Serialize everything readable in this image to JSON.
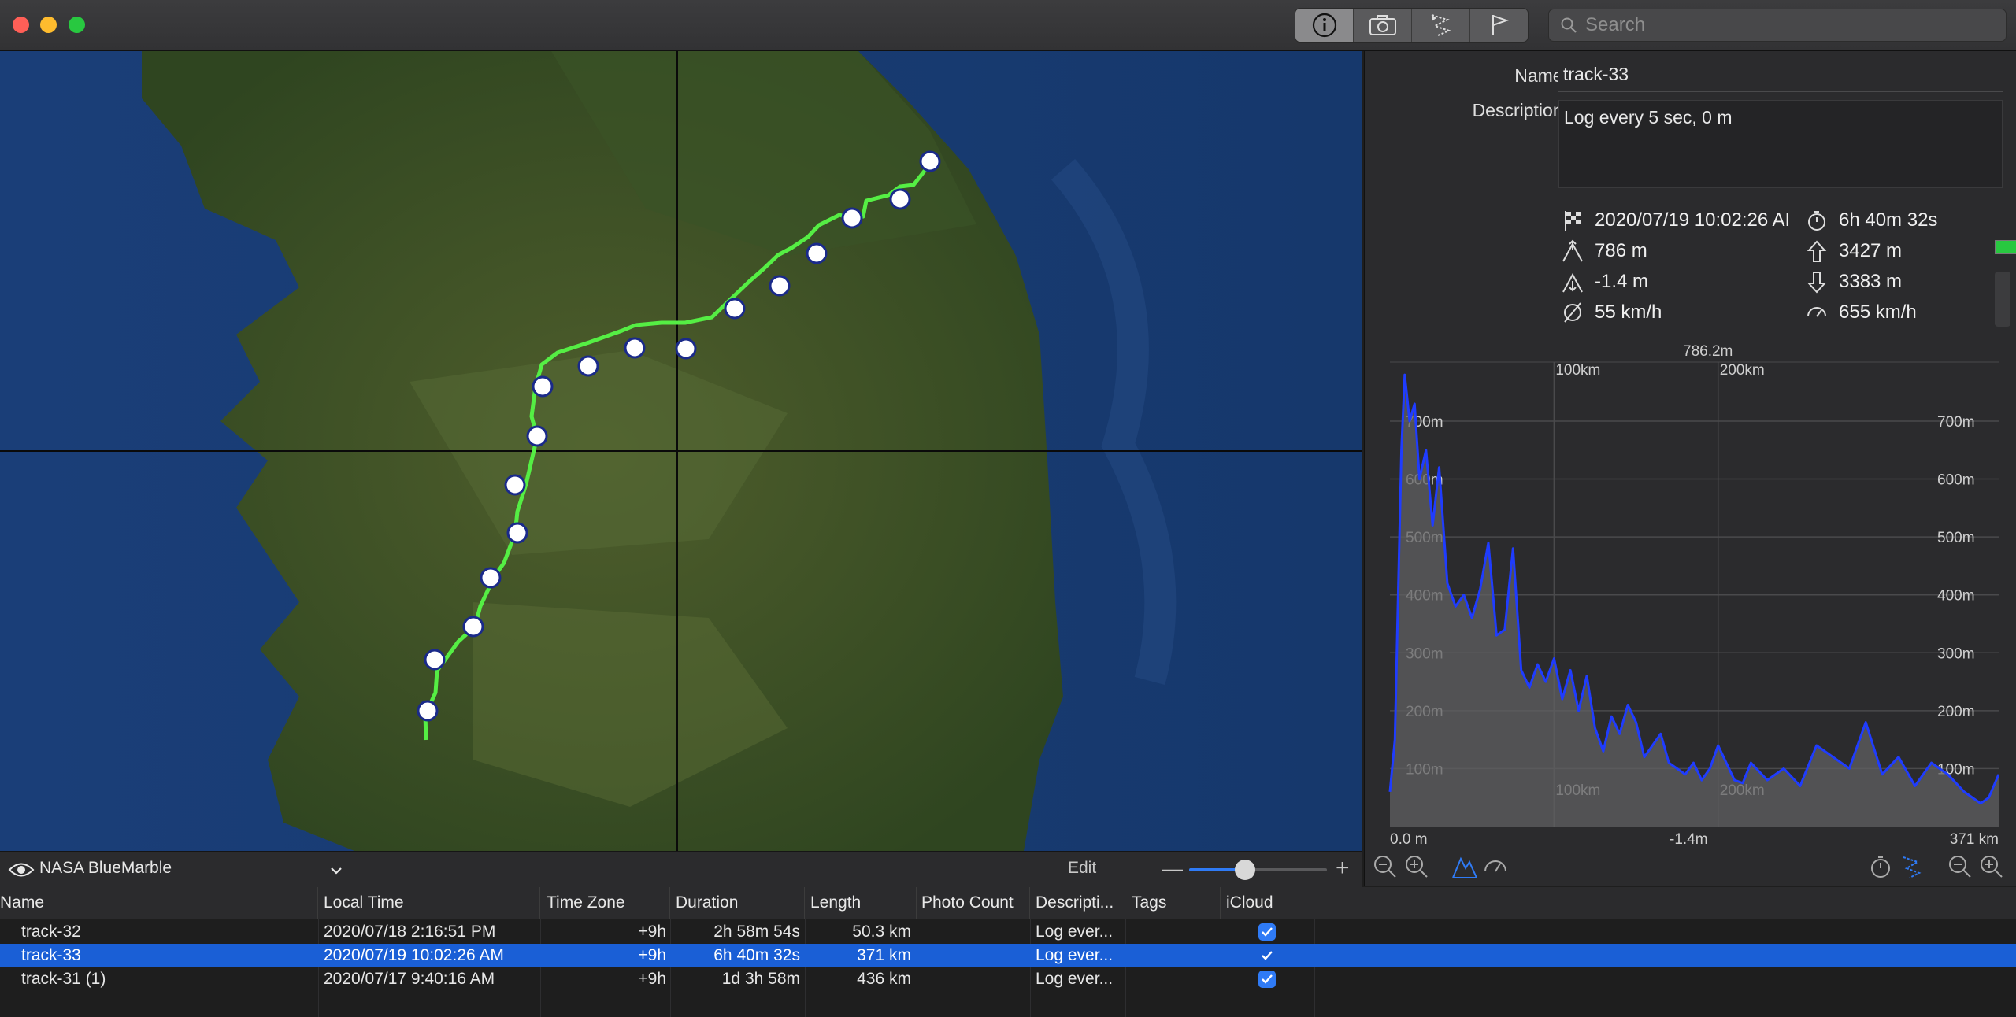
{
  "toolbar": {
    "search_placeholder": "Search",
    "buttons": [
      "info-icon",
      "camera-icon",
      "track-icon",
      "flag-icon"
    ]
  },
  "map": {
    "layer_name": "NASA BlueMarble",
    "edit_label": "Edit",
    "zoom_level": 0.35
  },
  "info": {
    "name_label": "Name:",
    "name_value": "track-33",
    "description_label": "Description:",
    "description_value": "Log every 5 sec, 0 m",
    "start_time": "2020/07/19 10:02:26 AI",
    "duration": "6h 40m 32s",
    "max_elevation": "786 m",
    "ascent": "3427 m",
    "min_elevation": "-1.4 m",
    "descent": "3383 m",
    "avg_speed": "55 km/h",
    "max_speed": "655 km/h"
  },
  "chart_data": {
    "type": "area",
    "peak_label": "786.2m",
    "min_label": "-1.4m",
    "x_start_label": "0.0 m",
    "x_end_label": "371 km",
    "x_ticks": [
      "100km",
      "200km"
    ],
    "y_ticks": [
      "700m",
      "600m",
      "500m",
      "400m",
      "300m",
      "200m",
      "100m"
    ],
    "ylim": [
      0,
      786.2
    ],
    "xlim": [
      0,
      371
    ],
    "x": [
      0,
      3,
      5,
      7,
      9,
      12,
      15,
      18,
      22,
      26,
      30,
      35,
      40,
      45,
      50,
      55,
      60,
      65,
      70,
      75,
      80,
      85,
      90,
      95,
      100,
      105,
      110,
      115,
      120,
      125,
      130,
      135,
      140,
      145,
      150,
      155,
      160,
      165,
      170,
      175,
      180,
      185,
      190,
      195,
      200,
      205,
      210,
      215,
      220,
      230,
      240,
      250,
      260,
      270,
      280,
      290,
      300,
      310,
      320,
      330,
      340,
      350,
      360,
      365,
      371
    ],
    "y": [
      60,
      150,
      400,
      650,
      780,
      700,
      730,
      600,
      650,
      520,
      620,
      420,
      380,
      400,
      360,
      410,
      490,
      330,
      340,
      480,
      270,
      240,
      280,
      250,
      290,
      220,
      270,
      200,
      260,
      170,
      130,
      190,
      160,
      210,
      180,
      120,
      140,
      160,
      110,
      100,
      90,
      110,
      80,
      100,
      140,
      110,
      80,
      75,
      110,
      80,
      100,
      70,
      140,
      120,
      100,
      180,
      90,
      120,
      70,
      110,
      90,
      60,
      40,
      50,
      90
    ]
  },
  "table": {
    "columns": [
      "Name",
      "Local Time",
      "Time Zone",
      "Duration",
      "Length",
      "Photo Count",
      "Descripti...",
      "Tags",
      "iCloud"
    ],
    "rows": [
      {
        "name": "track-32",
        "local_time": "2020/07/18 2:16:51 PM",
        "time_zone": "+9h",
        "duration": "2h 58m 54s",
        "length": "50.3 km",
        "photo_count": "",
        "description": "Log ever...",
        "tags": "",
        "icloud": true,
        "selected": false
      },
      {
        "name": "track-33",
        "local_time": "2020/07/19 10:02:26 AM",
        "time_zone": "+9h",
        "duration": "6h 40m 32s",
        "length": "371 km",
        "photo_count": "",
        "description": "Log ever...",
        "tags": "",
        "icloud": true,
        "selected": true
      },
      {
        "name": "track-31 (1)",
        "local_time": "2020/07/17 9:40:16 AM",
        "time_zone": "+9h",
        "duration": "1d 3h 58m",
        "length": "436 km",
        "photo_count": "",
        "description": "Log ever...",
        "tags": "",
        "icloud": true,
        "selected": false
      }
    ]
  },
  "colors": {
    "accent": "#2f7bf6",
    "track": "#3cf03c",
    "selection": "#1a5fd6",
    "elevation_line": "#1f3cff"
  }
}
